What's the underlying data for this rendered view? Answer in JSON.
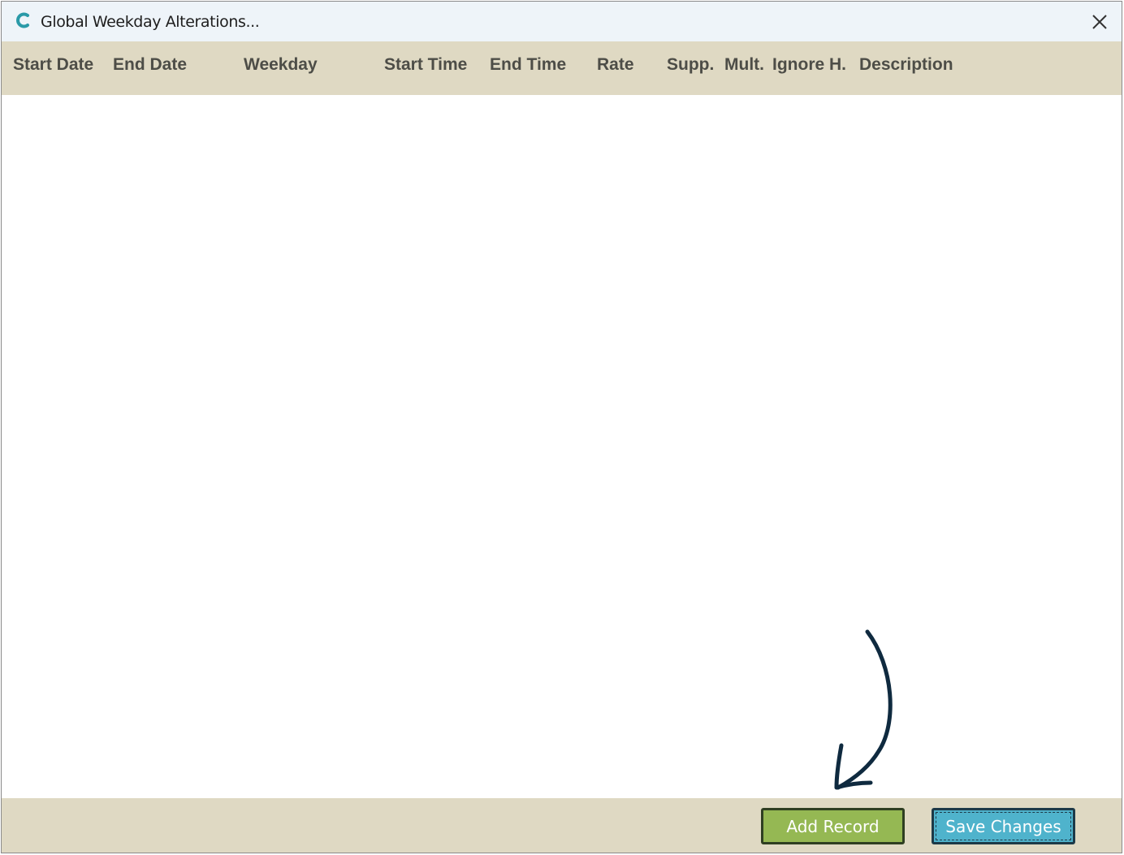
{
  "window": {
    "title": "Global Weekday Alterations...",
    "icon": "c-logo-icon",
    "close_icon": "close-icon"
  },
  "grid": {
    "columns": [
      "Start Date",
      "End Date",
      "Weekday",
      "Start Time",
      "End Time",
      "Rate",
      "Supp.",
      "Mult.",
      "Ignore H.",
      "Description"
    ],
    "rows": []
  },
  "footer": {
    "add_label": "Add Record",
    "save_label": "Save Changes"
  },
  "colors": {
    "header_bg": "#dfd9c3",
    "titlebar_bg": "#eef4f9",
    "add_button": "#95b853",
    "save_button": "#4fb3cc",
    "annotation_arrow": "#0f2a3f"
  }
}
